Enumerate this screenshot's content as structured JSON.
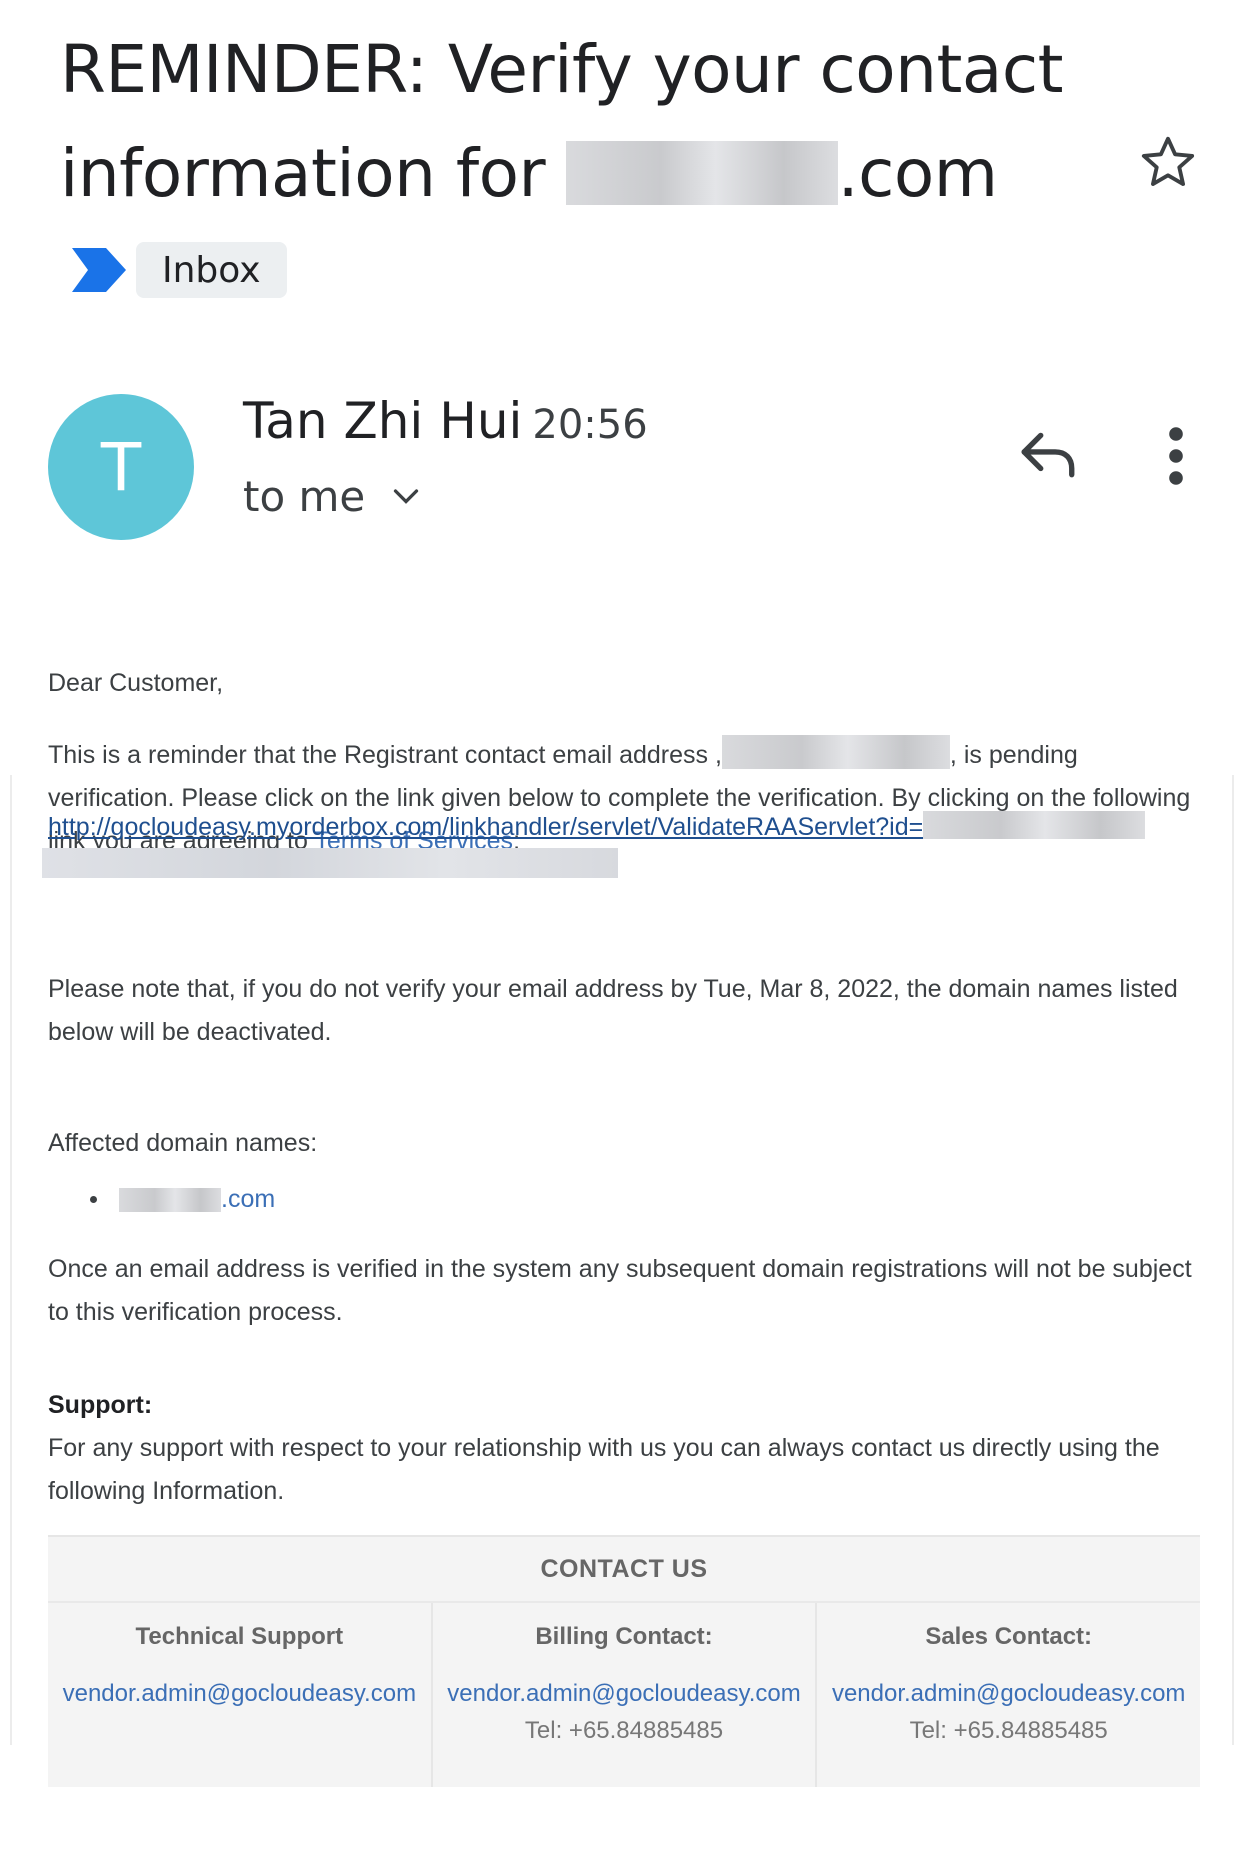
{
  "subject": {
    "line1": "REMINDER: Verify your contact",
    "prefix": "information for ",
    "suffix": ".com"
  },
  "labels": {
    "inbox": "Inbox"
  },
  "sender": {
    "initial": "T",
    "name": "Tan Zhi Hui",
    "time": "20:56",
    "recipient": "to me"
  },
  "body": {
    "greeting": "Dear Customer,",
    "reminder_before": "This is a reminder that the Registrant contact email address ,",
    "reminder_after": ", is pending verification. Please click on the link given below to complete the verification. By clicking on the following link you are agreeing to ",
    "tos_link": "Terms of Services",
    "tos_after": ":",
    "verify_url": "http://gocloudeasy.myorderbox.com/linkhandler/servlet/ValidateRAAServlet?id=",
    "note": "Please note that, if you do not verify your email address by Tue, Mar 8, 2022, the domain names listed below will be deactivated.",
    "affected_heading": "Affected domain names:",
    "domain_suffix": ".com",
    "once_verified": "Once an email address is verified in the system any subsequent domain registrations will not be subject to this verification process.",
    "support_heading": "Support:",
    "support_text": "For any support with respect to your relationship with us you can always contact us directly using the following Information."
  },
  "contact": {
    "title": "CONTACT US",
    "columns": [
      {
        "heading": "Technical Support",
        "email": "vendor.admin@gocloudeasy.com",
        "tel": ""
      },
      {
        "heading": "Billing Contact:",
        "email": "vendor.admin@gocloudeasy.com",
        "tel": "Tel: +65.84885485"
      },
      {
        "heading": "Sales Contact:",
        "email": "vendor.admin@gocloudeasy.com",
        "tel": "Tel: +65.84885485"
      }
    ]
  },
  "icons": {
    "star": "star-outline-icon",
    "importance": "importance-marker-icon",
    "reply": "reply-icon",
    "more": "more-vertical-icon",
    "chevron": "chevron-down-icon"
  },
  "colors": {
    "avatar": "#5ec6d8",
    "importance": "#1a73e8",
    "link": "#3b6fb6"
  }
}
